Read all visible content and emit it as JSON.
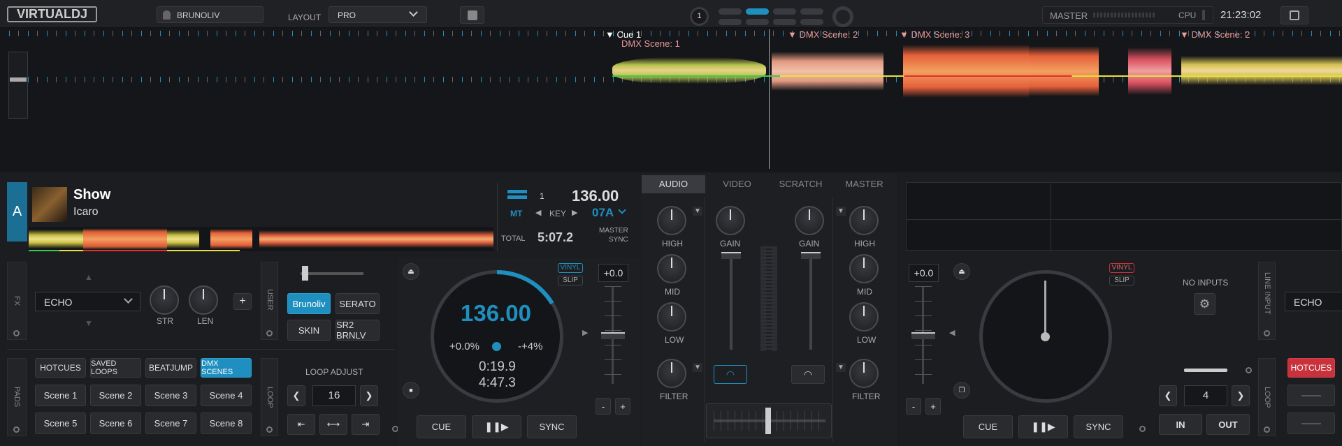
{
  "topbar": {
    "logo": "VIRTUALDJ",
    "user": "BRUNOLIV",
    "layout_label": "LAYOUT",
    "layout_value": "PRO",
    "deck_number": "1",
    "master_label": "MASTER",
    "cpu_label": "CPU",
    "clock": "21:23:02"
  },
  "waveform": {
    "cues": [
      "Cue 1",
      "DMX Scene: 1",
      "DMX Scene: 2",
      "DMX Scene: 3",
      "DMX Scene: 2"
    ]
  },
  "deckA": {
    "letter": "A",
    "title": "Show",
    "artist": "Icaro",
    "deck_num": "1",
    "bpm": "136.00",
    "mt": "MT",
    "key_label": "KEY",
    "key_value": "07A",
    "total_label": "TOTAL",
    "total_value": "5:07.2",
    "master_sync": "MASTER\nSYNC",
    "fx_label": "FX",
    "fx_value": "ECHO",
    "str_label": "STR",
    "len_label": "LEN",
    "user_label": "USER",
    "btn_brunoliv": "Brunoliv",
    "btn_serato": "SERATO",
    "btn_skin": "SKIN",
    "btn_sr2": "SR2 BRNLV",
    "pads_label": "PADS",
    "pad_modes": [
      "HOTCUES",
      "SAVED LOOPS",
      "BEATJUMP",
      "DMX SCENES"
    ],
    "scenes": [
      "Scene 1",
      "Scene 2",
      "Scene 3",
      "Scene 4",
      "Scene 5",
      "Scene 6",
      "Scene 7",
      "Scene 8"
    ],
    "loop_label": "LOOP",
    "loop_adjust": "LOOP ADJUST",
    "loop_value": "16",
    "vinyl": "VINYL",
    "slip": "SLIP",
    "jog_bpm": "136.00",
    "jog_pitch": "+0.0%",
    "jog_range": "-+4%",
    "jog_elapsed": "0:19.9",
    "jog_remain": "4:47.3",
    "pitch_value": "+0.0",
    "cue": "CUE",
    "sync": "SYNC",
    "minus": "-",
    "plus": "+"
  },
  "mixer": {
    "tabs": [
      "AUDIO",
      "VIDEO",
      "SCRATCH",
      "MASTER"
    ],
    "high": "HIGH",
    "mid": "MID",
    "low": "LOW",
    "filter": "FILTER",
    "gain": "GAIN"
  },
  "deckB": {
    "pitch_value": "+0.0",
    "vinyl": "VINYL",
    "slip": "SLIP",
    "no_inputs": "NO INPUTS",
    "line_input": "LINE INPUT",
    "fx_value": "ECHO",
    "hotcues": "HOTCUES",
    "loop_label": "LOOP",
    "loop_value": "4",
    "in": "IN",
    "out": "OUT",
    "cue": "CUE",
    "sync": "SYNC",
    "minus": "-",
    "plus": "+"
  },
  "colors": {
    "accent_blue": "#1f8fbf",
    "hotcue_red": "#c8323c"
  }
}
